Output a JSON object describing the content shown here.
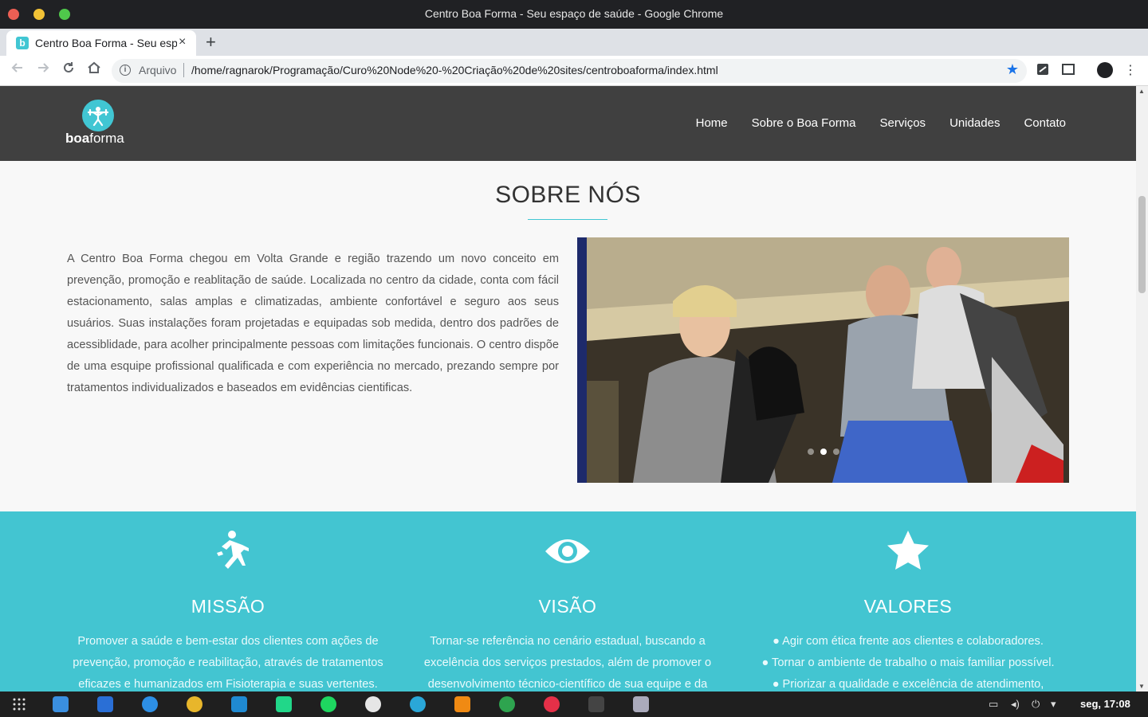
{
  "window": {
    "title": "Centro Boa Forma - Seu espaço de saúde - Google Chrome"
  },
  "tab": {
    "title": "Centro Boa Forma - Seu espaço de saúde",
    "favicon_letter": "b",
    "close": "×",
    "new_tab": "+"
  },
  "toolbar": {
    "security_label": "Arquivo",
    "url": "/home/ragnarok/Programação/Curo%20Node%20-%20Criação%20de%20sites/centroboaforma/index.html",
    "icons": [
      "back-icon",
      "forward-icon",
      "reload-icon",
      "home-icon",
      "bookmark-star-icon",
      "extension-icon",
      "cast-icon",
      "profile-avatar",
      "menu-icon"
    ]
  },
  "site": {
    "logo": {
      "bold": "boa",
      "rest": "forma"
    },
    "nav": [
      "Home",
      "Sobre o Boa Forma",
      "Serviços",
      "Unidades",
      "Contato"
    ],
    "about": {
      "title": "SOBRE NÓS",
      "text": "A Centro Boa Forma chegou em Volta Grande e região trazendo um novo conceito em prevenção, promoção e reablitação de saúde. Localizada no centro da cidade, conta com fácil estacionamento, salas amplas e climatizadas, ambiente confortável e seguro aos seus usuários. Suas instalações foram projetadas e equipadas sob medida, dentro dos padrões de acessiblidade, para acolher principalmente pessoas com limitações funcionais. O centro dispõe de uma esquipe profissional qualificada e com experiência no mercado, prezando sempre por tratamentos individualizados e baseados em evidências cientificas.",
      "carousel": {
        "slides": 3,
        "active": 2
      }
    },
    "columns": [
      {
        "icon": "running-person-icon",
        "title": "MISSÃO",
        "lines": [
          "Promover a saúde e bem-estar dos clientes com ações de",
          "prevenção, promoção e reabilitação, através de tratamentos",
          "eficazes e humanizados em Fisioterapia e suas vertentes."
        ]
      },
      {
        "icon": "eye-icon",
        "title": "VISÃO",
        "lines": [
          "Tornar-se referência no cenário estadual, buscando a",
          "excelência dos serviços prestados, além de promover o",
          "desenvolvimento técnico-científico de sua equipe e da"
        ]
      },
      {
        "icon": "star-icon",
        "title": "VALORES",
        "lines": [
          "● Agir com ética frente aos clientes e colaboradores.",
          "● Tornar o ambiente de trabalho o mais familiar possível.",
          "● Priorizar a qualidade e excelência de atendimento,"
        ]
      }
    ]
  },
  "taskbar": {
    "clock": "seg, 17:08"
  },
  "colors": {
    "accent": "#43c5d1",
    "nav_bg": "#404040"
  }
}
